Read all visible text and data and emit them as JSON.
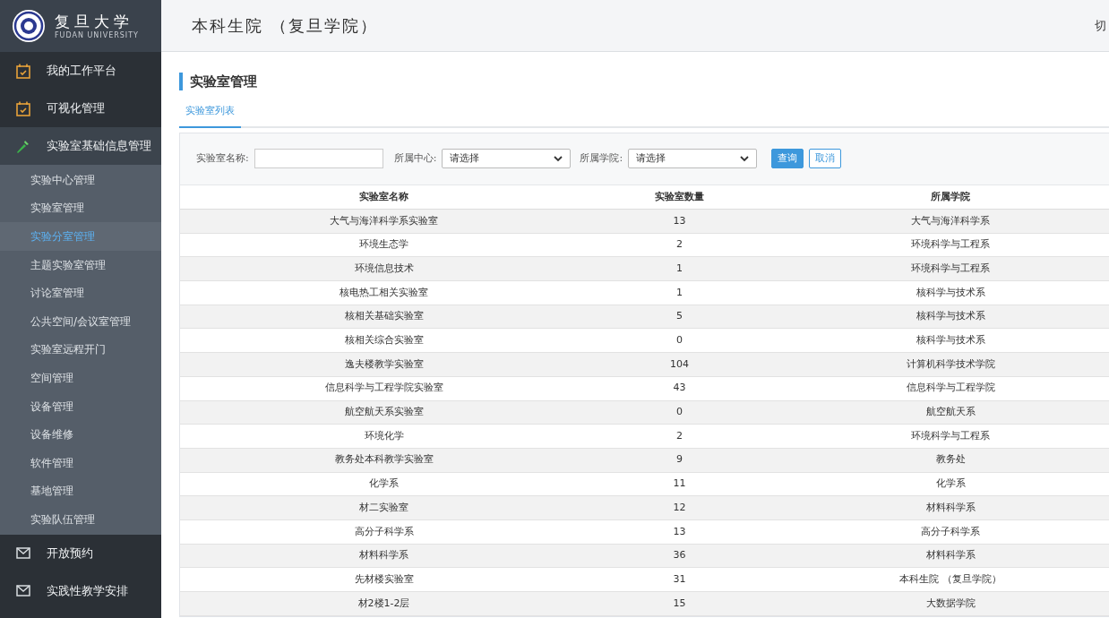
{
  "brand": {
    "name": "复旦大学",
    "subtitle": "FUDAN UNIVERSITY"
  },
  "header": {
    "title": "本科生院 （复旦学院）",
    "right_text": "切"
  },
  "sidebar": {
    "items": [
      {
        "label": "我的工作平台",
        "kind": "calendar",
        "selected": false
      },
      {
        "label": "可视化管理",
        "kind": "calendar",
        "selected": false
      },
      {
        "label": "实验室基础信息管理",
        "kind": "pipette",
        "expanded": true,
        "selected": true,
        "children": [
          {
            "label": "实验中心管理",
            "selected": false
          },
          {
            "label": "实验室管理",
            "selected": false
          },
          {
            "label": "实验分室管理",
            "selected": true
          },
          {
            "label": "主题实验室管理",
            "selected": false
          },
          {
            "label": "讨论室管理",
            "selected": false
          },
          {
            "label": "公共空间/会议室管理",
            "selected": false
          },
          {
            "label": "实验室远程开门",
            "selected": false
          },
          {
            "label": "空间管理",
            "selected": false
          },
          {
            "label": "设备管理",
            "selected": false
          },
          {
            "label": "设备维修",
            "selected": false
          },
          {
            "label": "软件管理",
            "selected": false
          },
          {
            "label": "基地管理",
            "selected": false
          },
          {
            "label": "实验队伍管理",
            "selected": false
          }
        ]
      },
      {
        "label": "开放预约",
        "kind": "mail",
        "selected": false
      },
      {
        "label": "实践性教学安排",
        "kind": "mail",
        "selected": false
      }
    ]
  },
  "page_title": "实验室管理",
  "tabs": [
    {
      "label": "实验室列表",
      "selected": true
    }
  ],
  "filters": {
    "fields": [
      {
        "kind": "text",
        "label": "实验室名称:"
      },
      {
        "kind": "select",
        "label": "所属中心:",
        "value": "请选择"
      },
      {
        "kind": "select",
        "label": "所属学院:",
        "value": "请选择"
      }
    ],
    "buttons": [
      {
        "label": "查询",
        "kind": "primary"
      },
      {
        "label": "取消",
        "kind": "outline"
      }
    ]
  },
  "table": {
    "columns": [
      "实验室名称",
      "实验室数量",
      "所属学院"
    ],
    "rows": [
      [
        "大气与海洋科学系实验室",
        "13",
        "大气与海洋科学系"
      ],
      [
        "环境生态学",
        "2",
        "环境科学与工程系"
      ],
      [
        "环境信息技术",
        "1",
        "环境科学与工程系"
      ],
      [
        "核电热工相关实验室",
        "1",
        "核科学与技术系"
      ],
      [
        "核相关基础实验室",
        "5",
        "核科学与技术系"
      ],
      [
        "核相关综合实验室",
        "0",
        "核科学与技术系"
      ],
      [
        "逸夫楼教学实验室",
        "104",
        "计算机科学技术学院"
      ],
      [
        "信息科学与工程学院实验室",
        "43",
        "信息科学与工程学院"
      ],
      [
        "航空航天系实验室",
        "0",
        "航空航天系"
      ],
      [
        "环境化学",
        "2",
        "环境科学与工程系"
      ],
      [
        "教务处本科教学实验室",
        "9",
        "教务处"
      ],
      [
        "化学系",
        "11",
        "化学系"
      ],
      [
        "材二实验室",
        "12",
        "材料科学系"
      ],
      [
        "高分子科学系",
        "13",
        "高分子科学系"
      ],
      [
        "材料科学系",
        "36",
        "材料科学系"
      ],
      [
        "先材楼实验室",
        "31",
        "本科生院 （复旦学院）"
      ],
      [
        "材2楼1-2层",
        "15",
        "大数据学院"
      ]
    ]
  }
}
